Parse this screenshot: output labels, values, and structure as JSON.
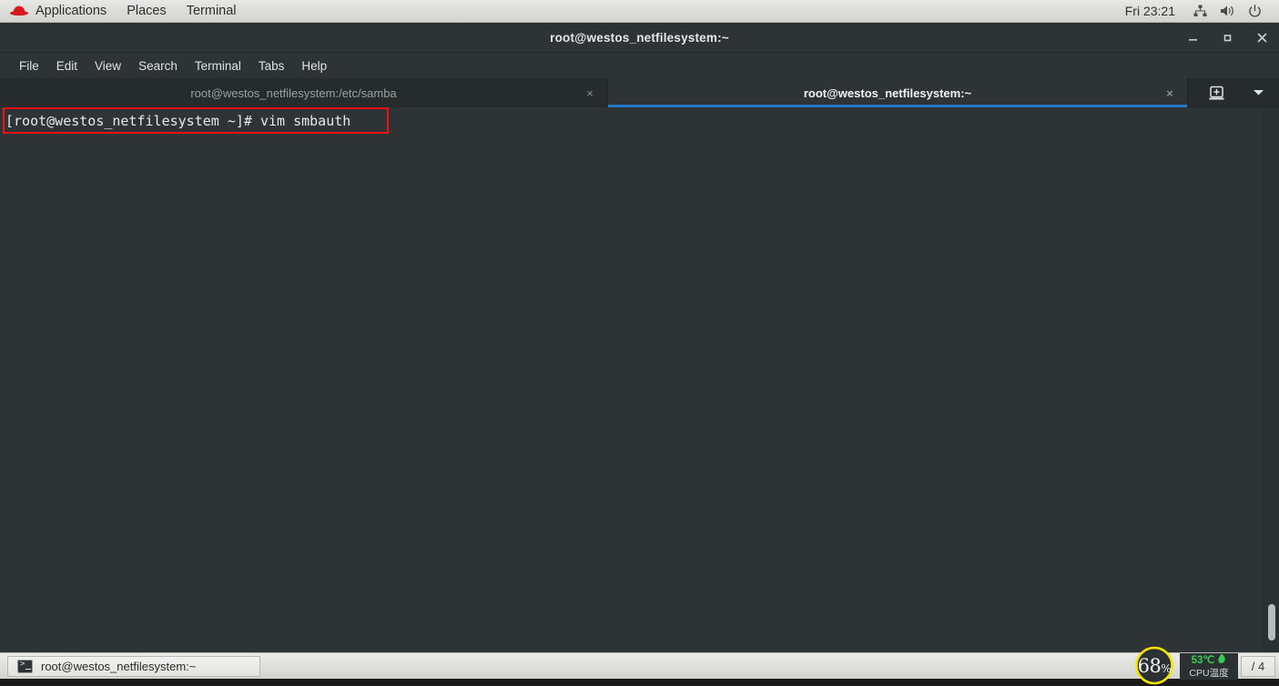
{
  "top_panel": {
    "logo_icon": "redhat-fedora-icon",
    "menus": [
      {
        "label": "Applications"
      },
      {
        "label": "Places"
      },
      {
        "label": "Terminal"
      }
    ],
    "clock": "Fri 23:21",
    "tray": [
      {
        "icon": "network-icon"
      },
      {
        "icon": "volume-icon"
      },
      {
        "icon": "power-icon"
      }
    ]
  },
  "window": {
    "title": "root@westos_netfilesystem:~",
    "controls": {
      "minimize": "minimize-icon",
      "maximize": "maximize-icon",
      "close": "close-icon"
    },
    "menubar": [
      {
        "label": "File"
      },
      {
        "label": "Edit"
      },
      {
        "label": "View"
      },
      {
        "label": "Search"
      },
      {
        "label": "Terminal"
      },
      {
        "label": "Tabs"
      },
      {
        "label": "Help"
      }
    ]
  },
  "tabs": {
    "items": [
      {
        "label": "root@westos_netfilesystem:/etc/samba",
        "close": "×",
        "active": false
      },
      {
        "label": "root@westos_netfilesystem:~",
        "close": "×",
        "active": true
      }
    ],
    "new_tab_icon": "new-tab-icon",
    "tab_list_icon": "chevron-down-icon"
  },
  "terminal": {
    "lines": [
      "[root@westos_netfilesystem ~]# vim smbauth"
    ],
    "content": "[root@westos_netfilesystem ~]# vim smbauth",
    "highlight_color": "#ee1111"
  },
  "bottom_panel": {
    "task": {
      "icon": "terminal-icon",
      "label": "root@westos_netfilesystem:~"
    },
    "cpu_gauge": {
      "value": "68",
      "unit": "%",
      "percent": 68,
      "ring_color": "#f5e400"
    },
    "temperature": {
      "value": "53℃",
      "icon": "leaf-icon",
      "label": "CPU温度",
      "color": "#39cc52"
    },
    "workspace": "/ 4"
  }
}
